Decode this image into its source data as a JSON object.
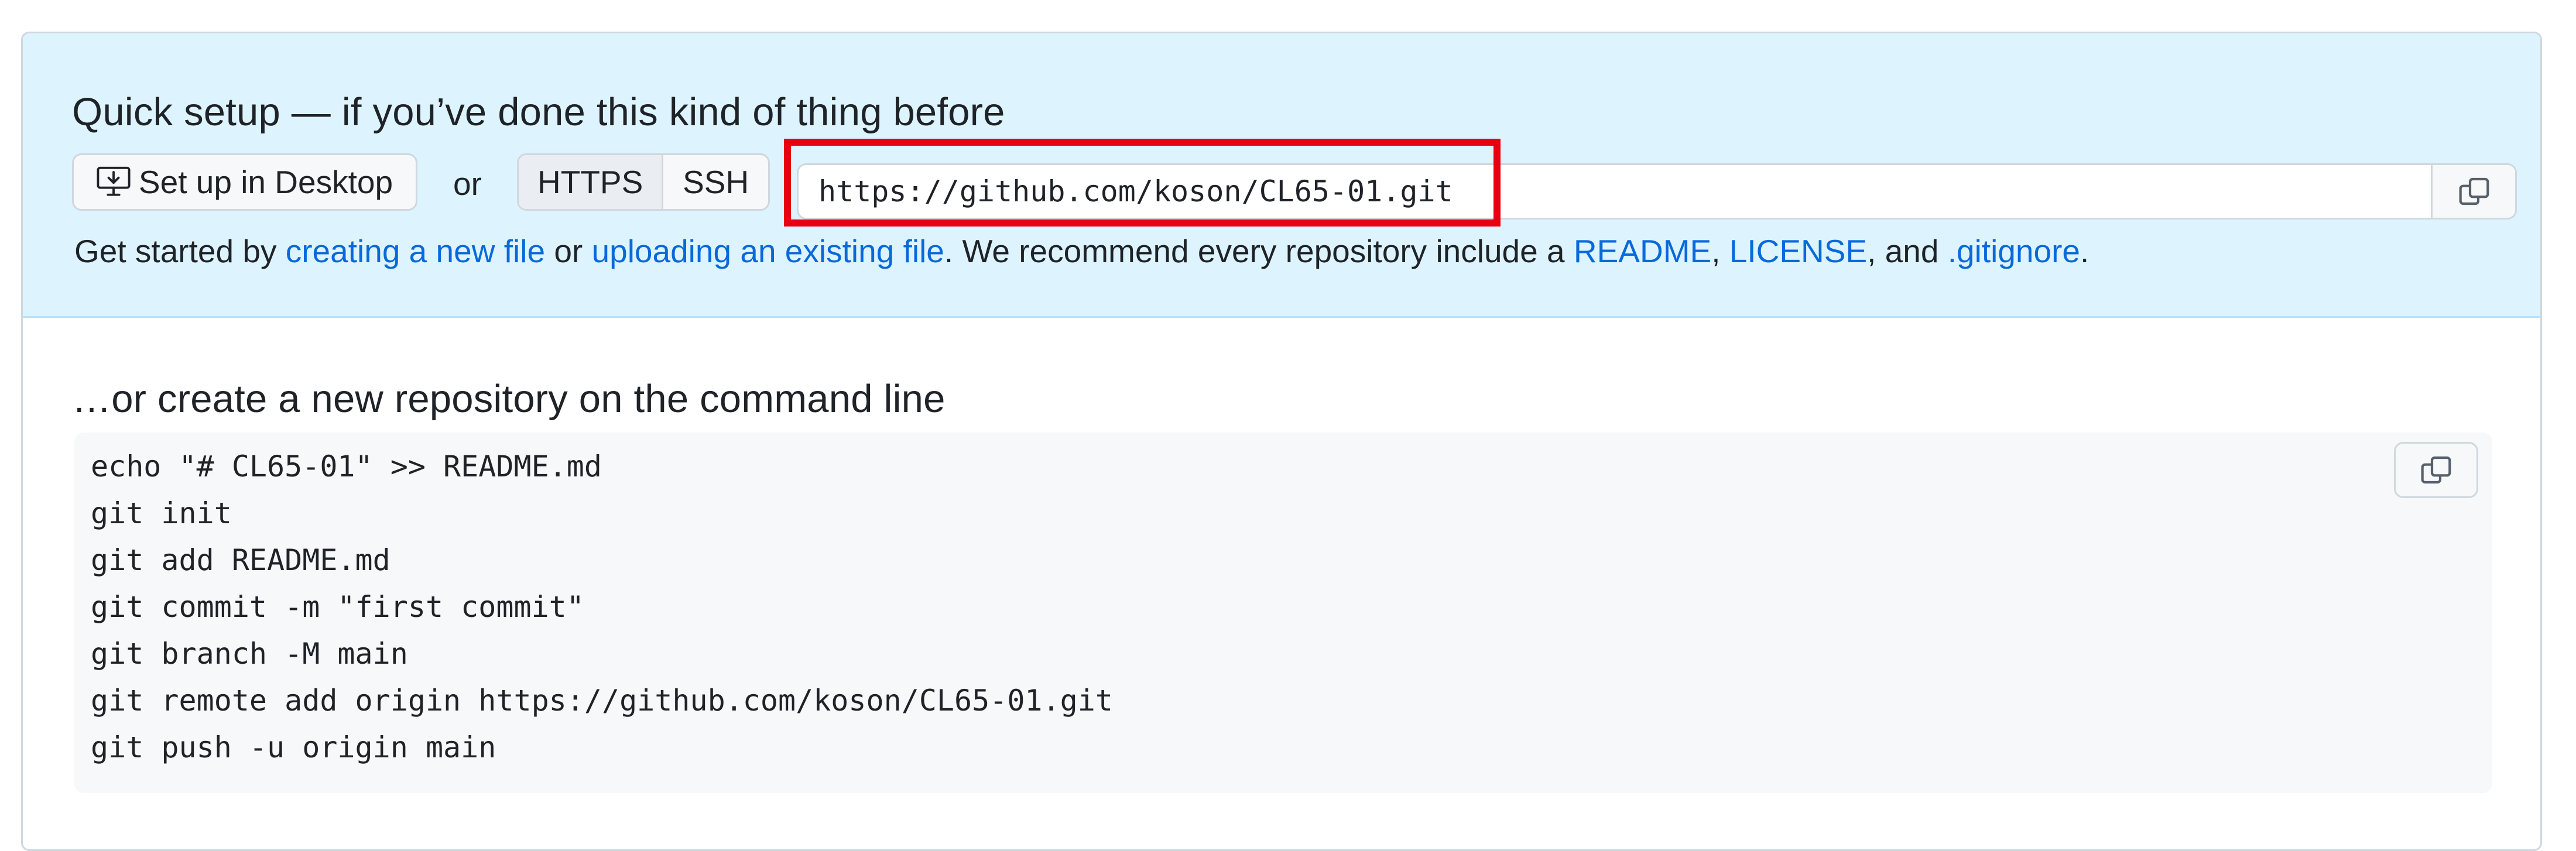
{
  "quick_setup": {
    "heading": "Quick setup — if you’ve done this kind of thing before",
    "desktop_button_label": "Set up in Desktop",
    "or_label": "or",
    "protocols": [
      "HTTPS",
      "SSH"
    ],
    "selected_protocol": "HTTPS",
    "clone_url": "https://github.com/koson/CL65-01.git",
    "hint": {
      "prefix": "Get started by ",
      "link_new_file": "creating a new file",
      "middle": " or ",
      "link_upload": "uploading an existing file",
      "recommend": ". We recommend every repository include a ",
      "link_readme": "README",
      "comma": ", ",
      "link_license": "LICENSE",
      "and": ", and ",
      "link_gitignore": ".gitignore",
      "suffix": "."
    }
  },
  "command_line": {
    "heading": "…or create a new repository on the command line",
    "lines": [
      "echo \"# CL65-01\" >> README.md",
      "git init",
      "git add README.md",
      "git commit -m \"first commit\"",
      "git branch -M main",
      "git remote add origin https://github.com/koson/CL65-01.git",
      "git push -u origin main"
    ]
  },
  "icons": {
    "desktop": "desktop-download-icon",
    "copy": "copy-icon"
  },
  "colors": {
    "quick_setup_bg": "#ddf4ff",
    "link": "#0969da",
    "highlight_box": "#e60012",
    "code_bg": "#f6f8fa"
  }
}
